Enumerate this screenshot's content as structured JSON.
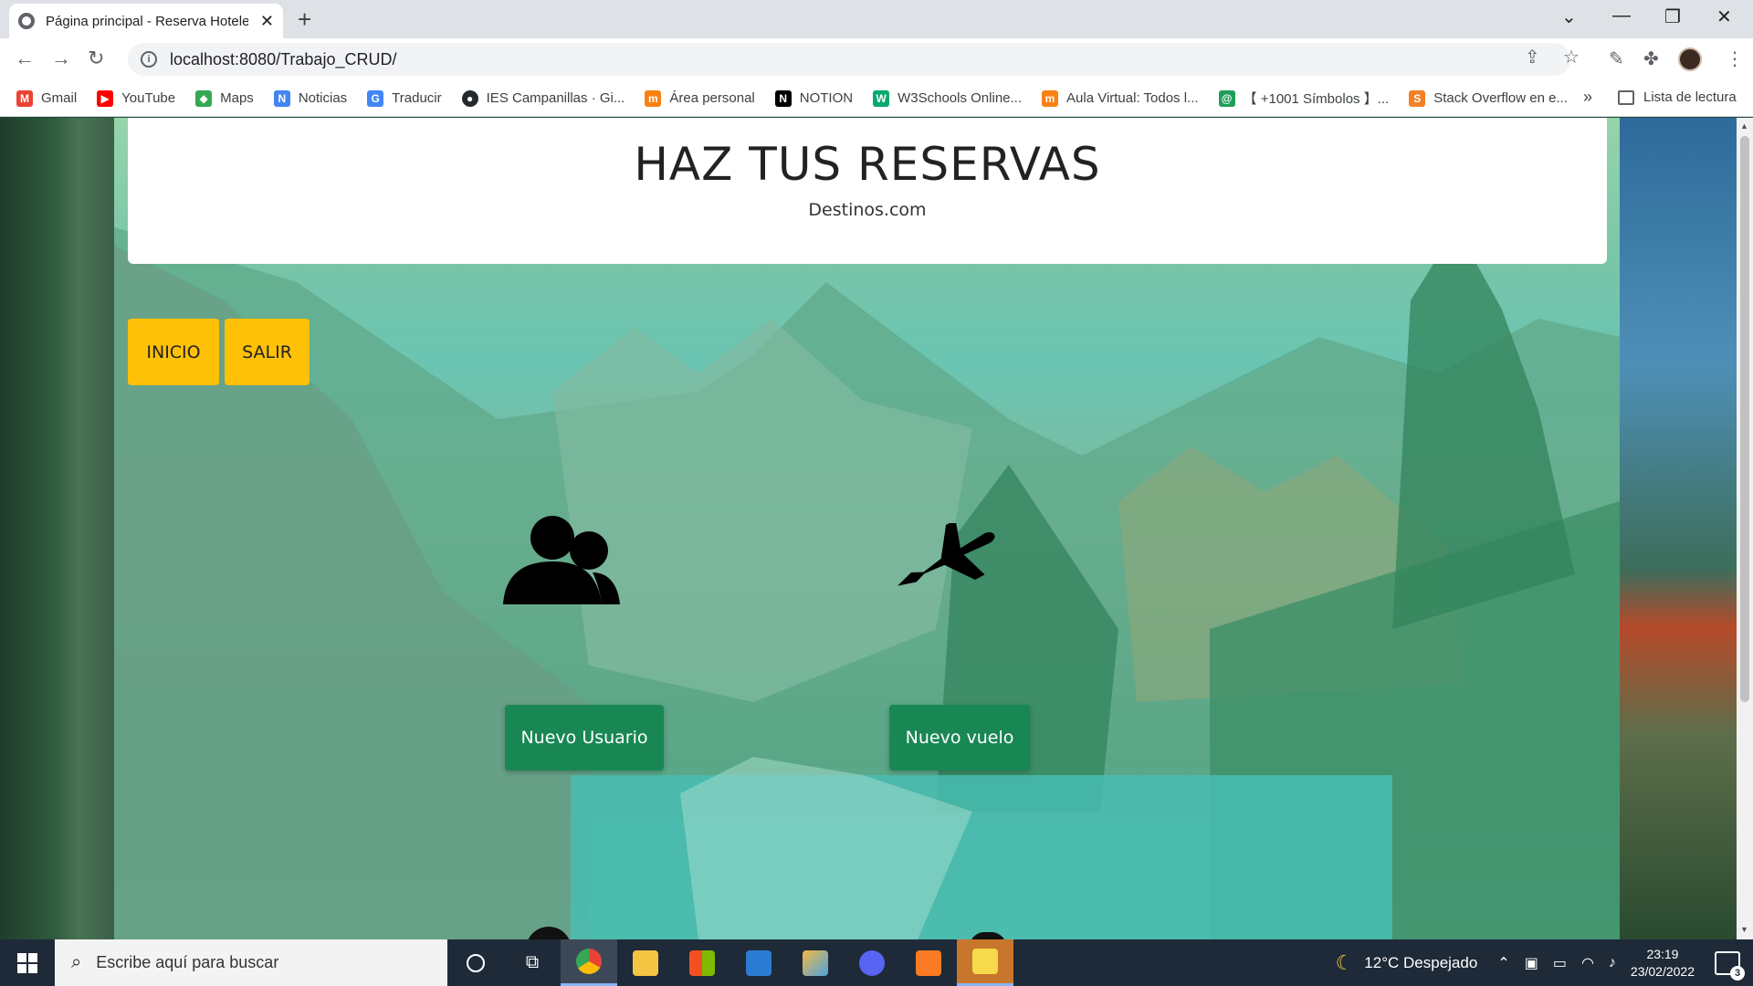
{
  "browser": {
    "tab_title": "Página principal - Reserva Hotele",
    "url": "localhost:8080/Trabajo_CRUD/",
    "new_tab_symbol": "+",
    "close_symbol": "✕"
  },
  "bookmarks": [
    {
      "label": "Gmail",
      "icon": "gmail-icon",
      "color": "#ea4335"
    },
    {
      "label": "YouTube",
      "icon": "youtube-icon",
      "color": "#ff0000"
    },
    {
      "label": "Maps",
      "icon": "maps-icon",
      "color": "#34a853"
    },
    {
      "label": "Noticias",
      "icon": "news-icon",
      "color": "#4285f4"
    },
    {
      "label": "Traducir",
      "icon": "translate-icon",
      "color": "#4285f4"
    },
    {
      "label": "IES Campanillas · Gi...",
      "icon": "github-icon",
      "color": "#24292e"
    },
    {
      "label": "Área personal",
      "icon": "moodle-icon",
      "color": "#f98012"
    },
    {
      "label": "NOTION",
      "icon": "notion-icon",
      "color": "#000000"
    },
    {
      "label": "W3Schools Online...",
      "icon": "w3schools-icon",
      "color": "#04aa6d"
    },
    {
      "label": "Aula Virtual: Todos l...",
      "icon": "moodle-icon",
      "color": "#f98012"
    },
    {
      "label": "【 +1001 Símbolos 】...",
      "icon": "symbols-icon",
      "color": "#1e9e5a"
    },
    {
      "label": "Stack Overflow en e...",
      "icon": "stackoverflow-icon",
      "color": "#f48024"
    }
  ],
  "bookmarks_more": "»",
  "reading_list": "Lista de lectura",
  "page": {
    "title": "HAZ TUS RESERVAS",
    "subtitle": "Destinos.com",
    "nav": {
      "inicio": "INICIO",
      "salir": "SALIR"
    },
    "features": [
      {
        "icon": "users-icon",
        "button": "Nuevo Usuario"
      },
      {
        "icon": "airplane-icon",
        "button": "Nuevo vuelo"
      }
    ]
  },
  "taskbar": {
    "search_placeholder": "Escribe aquí para buscar",
    "weather": "12°C  Despejado",
    "time": "23:19",
    "date": "23/02/2022",
    "notification_count": "3"
  }
}
